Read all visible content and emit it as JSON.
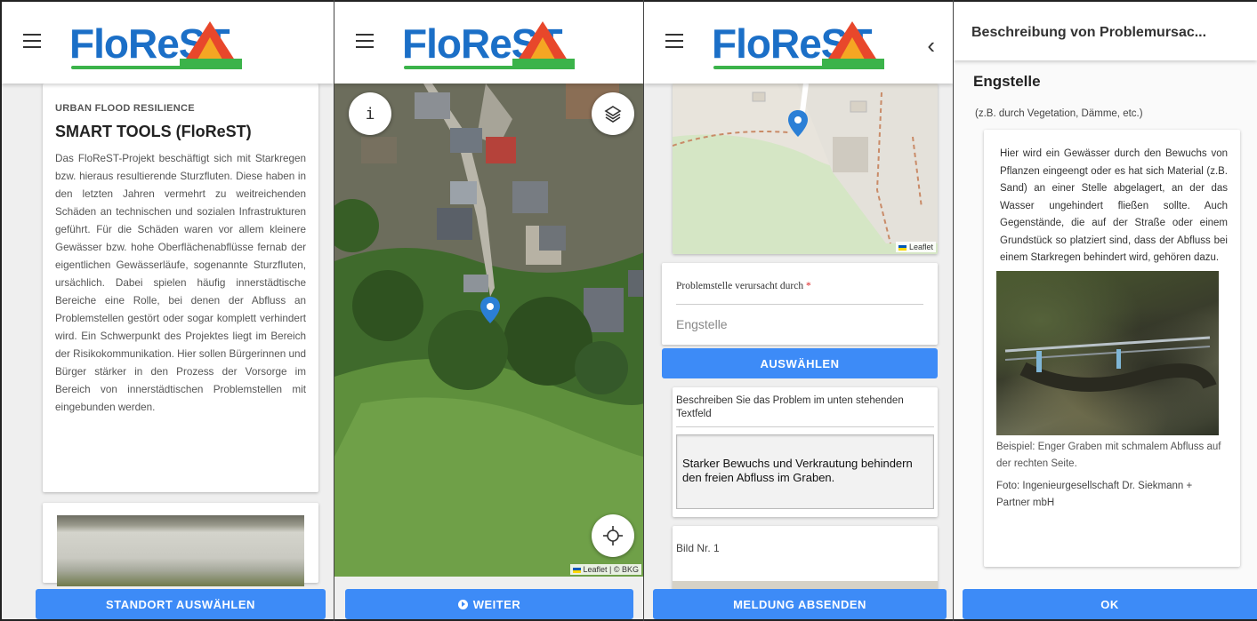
{
  "colors": {
    "primary_button": "#3d8bf7",
    "logo_blue": "#1b6fc7",
    "logo_green": "#3bb34a",
    "map_pin": "#2b7fd6",
    "required": "#dd2222"
  },
  "app": {
    "logo_text": "FloReST"
  },
  "panel1": {
    "overline": "URBAN FLOOD RESILIENCE",
    "title": "SMART TOOLS (FloReST)",
    "body": "Das FloReST-Projekt beschäftigt sich mit Starkregen bzw. hieraus resultierende Sturzfluten. Diese haben in den letzten Jahren vermehrt zu weitreichenden Schäden an technischen und sozialen Infrastrukturen geführt. Für die Schäden waren vor allem kleinere Gewässer bzw. hohe Oberflächenabflüsse fernab der eigentlichen Gewässerläufe, sogenannte Sturzfluten, ursächlich. Dabei spielen häufig innerstädtische Bereiche eine Rolle, bei denen der Abfluss an Problemstellen gestört oder sogar komplett verhindert wird. Ein Schwerpunkt des Projektes liegt im Bereich der Risikokommunikation. Hier sollen Bürgerinnen und Bürger stärker in den Prozess der Vorsorge im Bereich von innerstädtischen Problemstellen mit eingebunden werden.",
    "button": "STANDORT AUSWÄHLEN"
  },
  "panel2": {
    "info_icon": "info-icon",
    "layers_icon": "layers-icon",
    "locate_icon": "crosshair-icon",
    "info_label": "i",
    "attribution": "Leaflet | © BKG",
    "button_icon": "arrow-circle-icon",
    "button": "WEITER"
  },
  "panel3": {
    "attribution": "Leaflet",
    "cause_label": "Problemstelle verursacht durch",
    "cause_required": "*",
    "cause_value": "Engstelle",
    "select_button": "AUSWÄHLEN",
    "describe_label": "Beschreiben Sie das Problem im unten stehenden Textfeld",
    "description": "Starker Bewuchs und Verkrautung behindern den freien Abfluss im Graben.",
    "image_label": "Bild Nr. 1",
    "button": "MELDUNG ABSENDEN"
  },
  "panel4": {
    "title": "Beschreibung von Problemursac...",
    "heading": "Engstelle",
    "subtitle": "(z.B. durch Vegetation, Dämme, etc.)",
    "body": "Hier wird ein Gewässer durch den Bewuchs von Pflanzen eingeengt oder es hat sich Material (z.B. Sand) an einer Stelle abgelagert, an der das Wasser ungehindert fließen sollte. Auch Gegenstände, die auf der Straße oder einem Grundstück so platziert sind, dass der Abfluss bei einem Starkregen behindert wird, gehören dazu.",
    "caption": "Beispiel: Enger Graben mit schmalem Abfluss auf der rechten Seite.",
    "credit": "Foto: Ingenieurgesellschaft Dr. Siekmann + Partner mbH",
    "button": "OK"
  }
}
